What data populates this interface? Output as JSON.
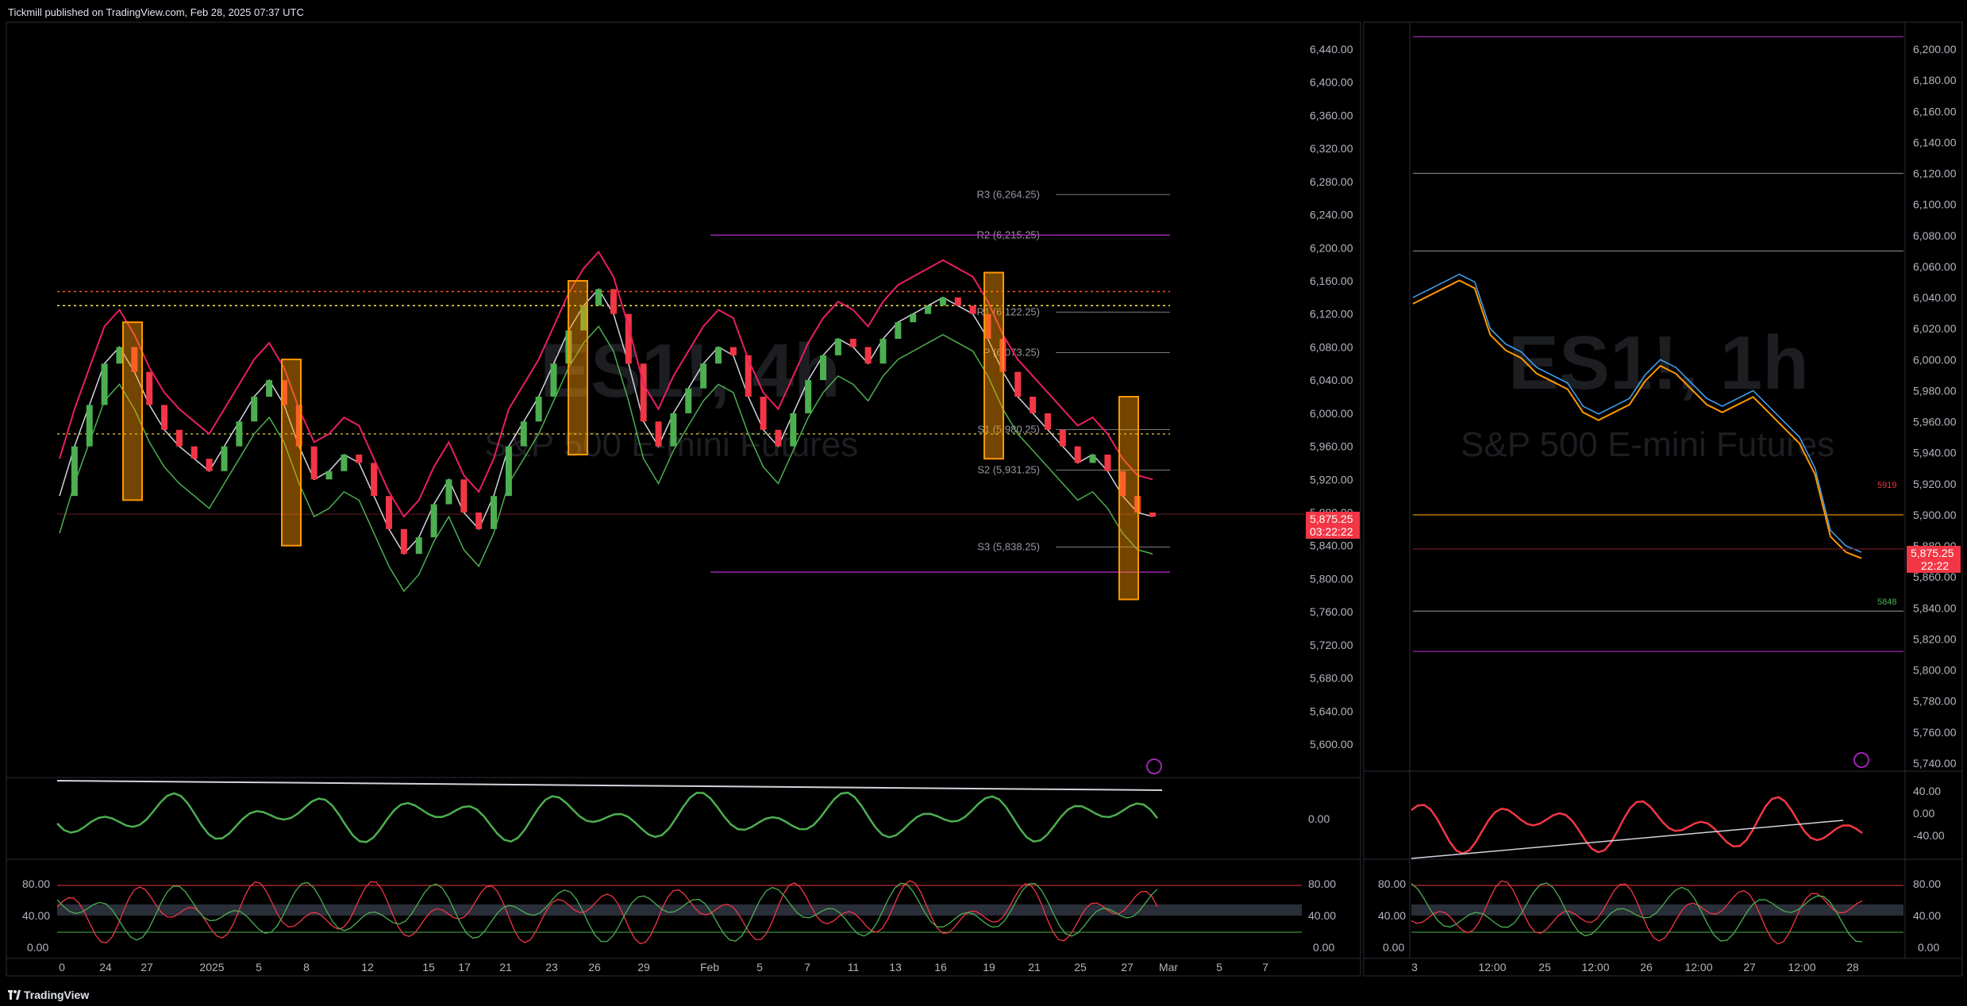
{
  "header": {
    "publisher": "Tickmill published on TradingView.com, Feb 28, 2025 07:37 UTC"
  },
  "footer": {
    "brand": "TradingView"
  },
  "colors": {
    "up": "#4caf50",
    "down": "#f23645",
    "pink": "#e91e63",
    "orange": "#ff9800",
    "purple": "#9c27b0",
    "blue": "#2962ff"
  },
  "chart_data": [
    {
      "type": "line",
      "panel": "left-daily",
      "watermark_symbol": "ES1!, 4h",
      "watermark_name": "S&P 500 E-mini Futures",
      "price_ticks": [
        "6,440.00",
        "6,400.00",
        "6,360.00",
        "6,320.00",
        "6,280.00",
        "6,240.00",
        "6,200.00",
        "6,160.00",
        "6,120.00",
        "6,080.00",
        "6,040.00",
        "6,000.00",
        "5,960.00",
        "5,920.00",
        "5,880.00",
        "5,840.00",
        "5,800.00",
        "5,760.00",
        "5,720.00",
        "5,680.00",
        "5,640.00",
        "5,600.00"
      ],
      "ylim": [
        5580,
        6460
      ],
      "x_ticks": [
        "0",
        "24",
        "27",
        "2025",
        "5",
        "8",
        "12",
        "15",
        "17",
        "21",
        "23",
        "26",
        "29",
        "Feb",
        "5",
        "7",
        "11",
        "13",
        "16",
        "19",
        "21",
        "25",
        "27",
        "Mar",
        "5",
        "7"
      ],
      "pivots": [
        {
          "label": "R3 (6,264.25)",
          "value": 6264.25
        },
        {
          "label": "R2 (6,215.25)",
          "value": 6215.25
        },
        {
          "label": "R1 (6,122.25)",
          "value": 6122.25
        },
        {
          "label": "P (6,073.25)",
          "value": 6073.25
        },
        {
          "label": "S1 (5,980.25)",
          "value": 5980.25
        },
        {
          "label": "S2 (5,931.25)",
          "value": 5931.25
        },
        {
          "label": "S3 (5,838.25)",
          "value": 5838.25
        }
      ],
      "last_price": "5,875.25",
      "countdown": "03:22:22",
      "close_series": [
        5900,
        5960,
        6010,
        6060,
        6080,
        6050,
        6010,
        5980,
        5960,
        5945,
        5930,
        5960,
        5990,
        6020,
        6040,
        6010,
        5960,
        5920,
        5930,
        5950,
        5940,
        5900,
        5860,
        5830,
        5850,
        5890,
        5920,
        5880,
        5860,
        5900,
        5960,
        5990,
        6020,
        6060,
        6100,
        6130,
        6150,
        6120,
        6060,
        5990,
        5960,
        6000,
        6030,
        6060,
        6080,
        6070,
        6020,
        5980,
        5960,
        6000,
        6040,
        6070,
        6090,
        6080,
        6060,
        6090,
        6110,
        6120,
        6130,
        6140,
        6130,
        6120,
        6090,
        6050,
        6020,
        6000,
        5980,
        5960,
        5940,
        5950,
        5930,
        5900,
        5880,
        5875
      ]
    },
    {
      "type": "line",
      "panel": "right-intraday",
      "watermark_symbol": "ES1!, 1h",
      "watermark_name": "S&P 500 E-mini Futures",
      "price_ticks": [
        "6,200.00",
        "6,180.00",
        "6,160.00",
        "6,140.00",
        "6,120.00",
        "6,100.00",
        "6,080.00",
        "6,060.00",
        "6,040.00",
        "6,020.00",
        "6,000.00",
        "5,980.00",
        "5,960.00",
        "5,940.00",
        "5,920.00",
        "5,900.00",
        "5,880.00",
        "5,860.00",
        "5,840.00",
        "5,820.00",
        "5,800.00",
        "5,780.00",
        "5,760.00",
        "5,740.00"
      ],
      "ylim": [
        5735,
        6215
      ],
      "x_ticks": [
        "3",
        "12:00",
        "25",
        "12:00",
        "26",
        "12:00",
        "27",
        "12:00",
        "28"
      ],
      "small_labels": [
        "5919",
        "5848"
      ],
      "last_price": "5,875.25",
      "countdown": "22:22",
      "close_series": [
        6040,
        6045,
        6050,
        6055,
        6050,
        6020,
        6010,
        6005,
        5995,
        5990,
        5985,
        5970,
        5965,
        5970,
        5975,
        5990,
        6000,
        5995,
        5985,
        5975,
        5970,
        5975,
        5980,
        5970,
        5960,
        5950,
        5930,
        5890,
        5880,
        5876
      ]
    },
    {
      "type": "line",
      "panel": "oscillator-1",
      "tick_labels_left": [
        "0.00"
      ],
      "tick_labels_right": [
        "40.00",
        "0.00",
        "-40.00"
      ]
    },
    {
      "type": "line",
      "panel": "oscillator-2-stochastic",
      "tick_labels": [
        "80.00",
        "40.00",
        "0.00"
      ]
    }
  ]
}
